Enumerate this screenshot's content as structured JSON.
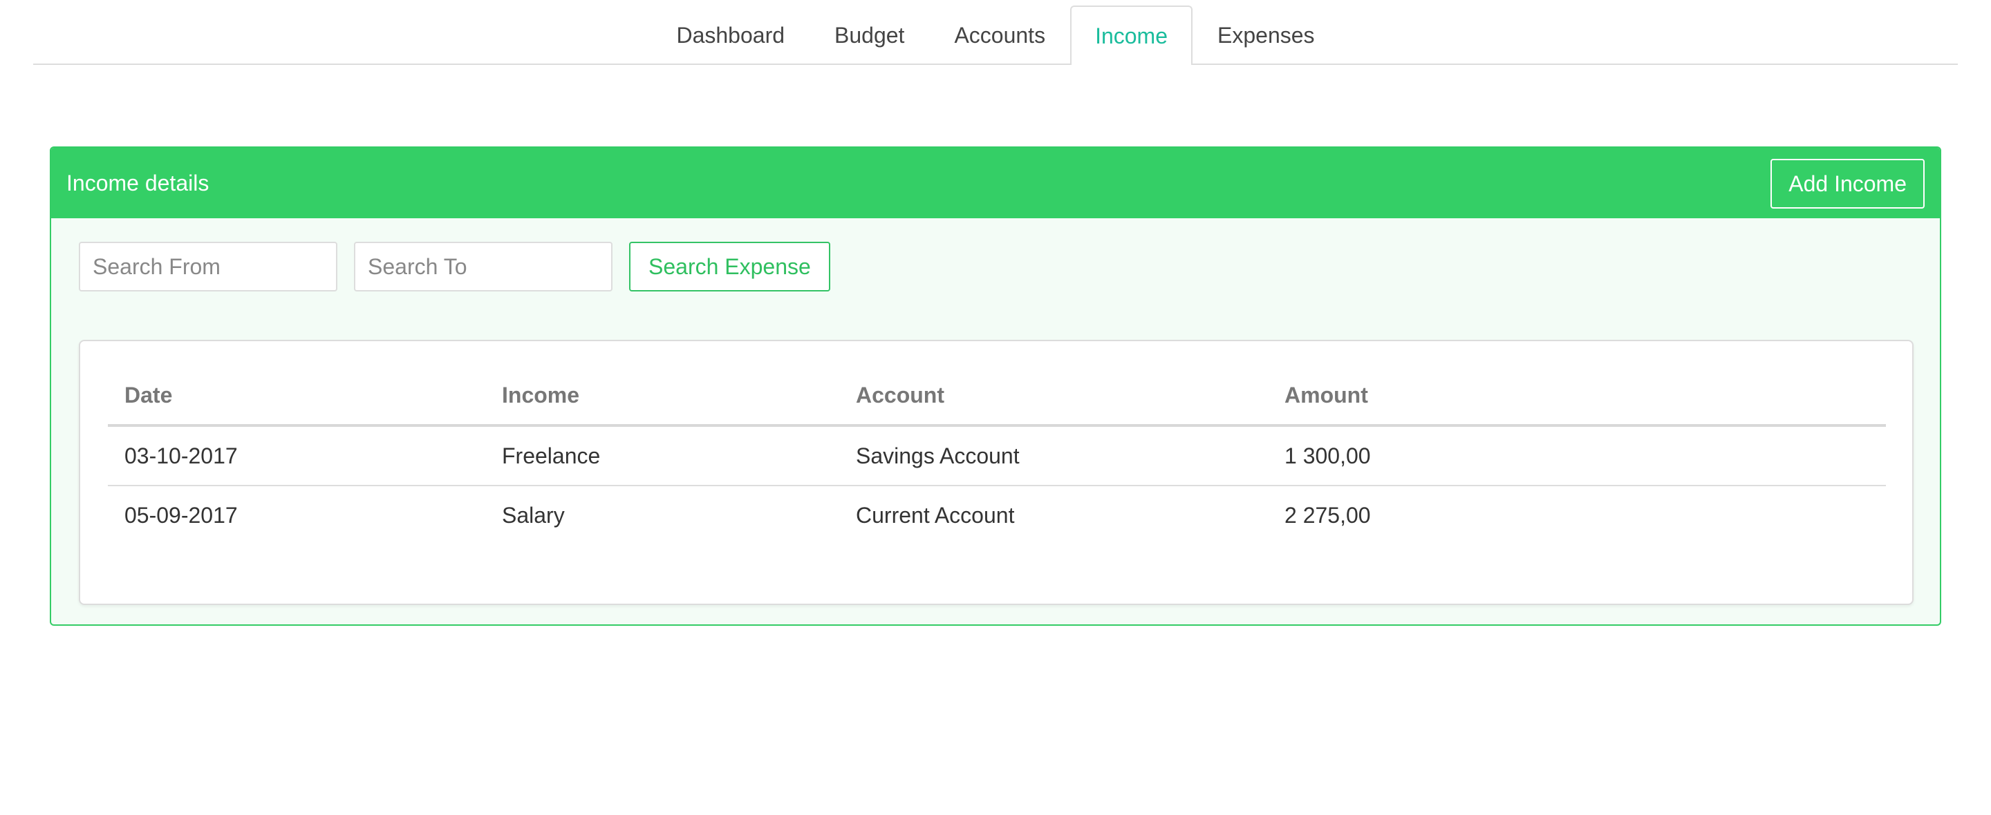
{
  "nav": {
    "tabs": [
      {
        "label": "Dashboard"
      },
      {
        "label": "Budget"
      },
      {
        "label": "Accounts"
      },
      {
        "label": "Income",
        "active": true
      },
      {
        "label": "Expenses"
      }
    ]
  },
  "panel": {
    "title": "Income details",
    "add_label": "Add Income"
  },
  "search": {
    "from_placeholder": "Search From",
    "to_placeholder": "Search To",
    "from_value": "",
    "to_value": "",
    "button_label": "Search Expense"
  },
  "table": {
    "headers": [
      "Date",
      "Income",
      "Account",
      "Amount"
    ],
    "rows": [
      [
        "03-10-2017",
        "Freelance",
        "Savings Account",
        "1 300,00"
      ],
      [
        "05-09-2017",
        "Salary",
        "Current Account",
        "2 275,00"
      ]
    ]
  },
  "colors": {
    "accent": "#1abc9c",
    "panel_header": "#34cf66",
    "panel_bg": "#f3fcf6"
  }
}
